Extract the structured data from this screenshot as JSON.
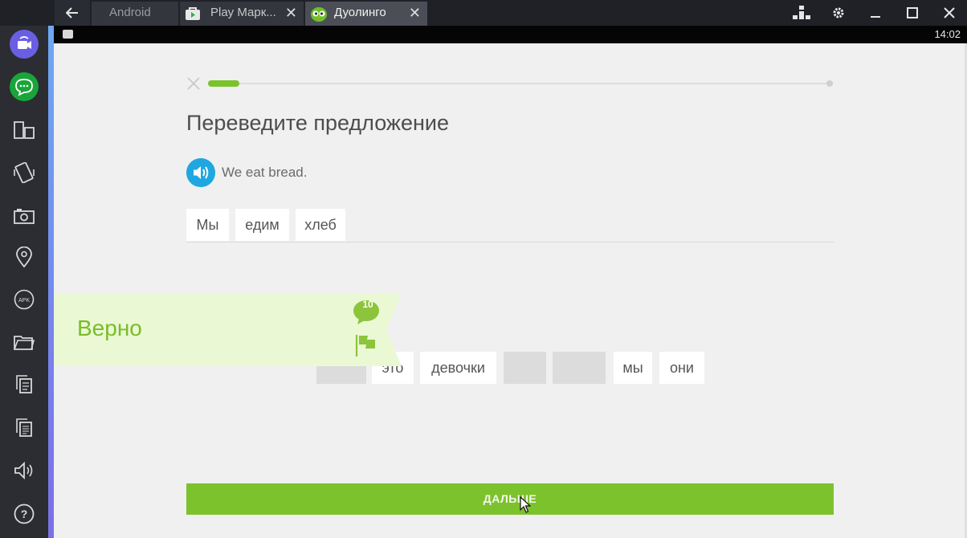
{
  "window": {
    "tabs": [
      {
        "label": "Android"
      },
      {
        "label": "Play Марк..."
      },
      {
        "label": "Дуолинго"
      }
    ],
    "close_glyph": "✕"
  },
  "status_bar": {
    "time": "14:02"
  },
  "sidebar": {
    "items": [
      {
        "icon": "video-call-icon"
      },
      {
        "icon": "chat-icon"
      },
      {
        "icon": "rotate-screen-icon"
      },
      {
        "icon": "shake-icon"
      },
      {
        "icon": "camera-icon"
      },
      {
        "icon": "location-icon"
      },
      {
        "icon": "apk-install-icon",
        "label": "APK"
      },
      {
        "icon": "folder-icon"
      },
      {
        "icon": "copy-icon"
      },
      {
        "icon": "paste-icon"
      },
      {
        "icon": "volume-icon"
      },
      {
        "icon": "help-icon",
        "label": "?"
      }
    ]
  },
  "lesson": {
    "progress_fraction": 0.05,
    "heading": "Переведите предложение",
    "prompt_sentence": "We eat bread.",
    "answer_words": [
      "Мы",
      "едим",
      "хлеб"
    ],
    "word_bank": [
      {
        "label": "",
        "used": true
      },
      {
        "label": "это",
        "used": false
      },
      {
        "label": "девочки",
        "used": false
      },
      {
        "label": "",
        "used": true
      },
      {
        "label": "",
        "used": true
      },
      {
        "label": "мы",
        "used": false
      },
      {
        "label": "они",
        "used": false
      }
    ],
    "verdict": {
      "text": "Верно",
      "comment_count": "10"
    },
    "continue_label": "ДАЛЬШЕ"
  },
  "colors": {
    "accent_green": "#7cc22d",
    "speaker_blue": "#1fa7e0",
    "banner_bg": "#ebf8d4"
  }
}
